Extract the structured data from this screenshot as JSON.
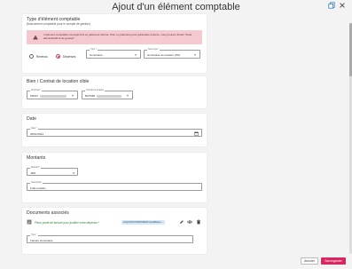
{
  "page": {
    "title": "Ajout d'un élément comptable"
  },
  "toolbar": {
    "icons": [
      "copy-icon",
      "close-icon"
    ]
  },
  "type_section": {
    "title": "Type d'élément comptable",
    "subtitle": "(Mouvement comptable pour le compte de gestion)",
    "alert_text": "L'élément comptable correspond à un paiement interne. Pour un paiement pour partenaire externe, vous pouvez choisir \"Frais administratif et de gestion\"",
    "radio_revenus": "Revenus",
    "radio_depenses": "Dépenses",
    "selected_radio": "Dépenses",
    "type_field": {
      "label": "Type *",
      "value": "Honoraires"
    },
    "sous_type_field": {
      "label": "Sous-type *",
      "value": "Honoraires de location (3%)"
    }
  },
  "property_section": {
    "title": "Bien / Contrat de location cible",
    "property_field": {
      "label": "Propriété *",
      "value": "PRAFI"
    },
    "contract_field": {
      "label": "Contrat de location",
      "value": "BAITMR"
    }
  },
  "date_section": {
    "title": "Date",
    "date_field": {
      "label": "Date *",
      "value": "30/01/2024"
    }
  },
  "amounts_section": {
    "title": "Montants",
    "amount_field": {
      "label": "Montant *",
      "value": "-800",
      "unit": "€"
    },
    "description_field": {
      "label": "Description",
      "value": "Frais location"
    }
  },
  "documents_section": {
    "title": "Documents associés",
    "doc_link": "Pièce jointe de facture pour justifier votre dépense *",
    "doc_badge": "ACQUISITION BATIMENT.Cloud/Backin ...",
    "type_field": {
      "label": "Type *",
      "value": "Facture Honoraires"
    }
  },
  "actions": {
    "cancel": "Annuler",
    "save": "Sauvegarder"
  },
  "colors": {
    "accent": "#d6285e",
    "alert_bg": "#f5c9d0",
    "link_green": "#2e7d32"
  }
}
